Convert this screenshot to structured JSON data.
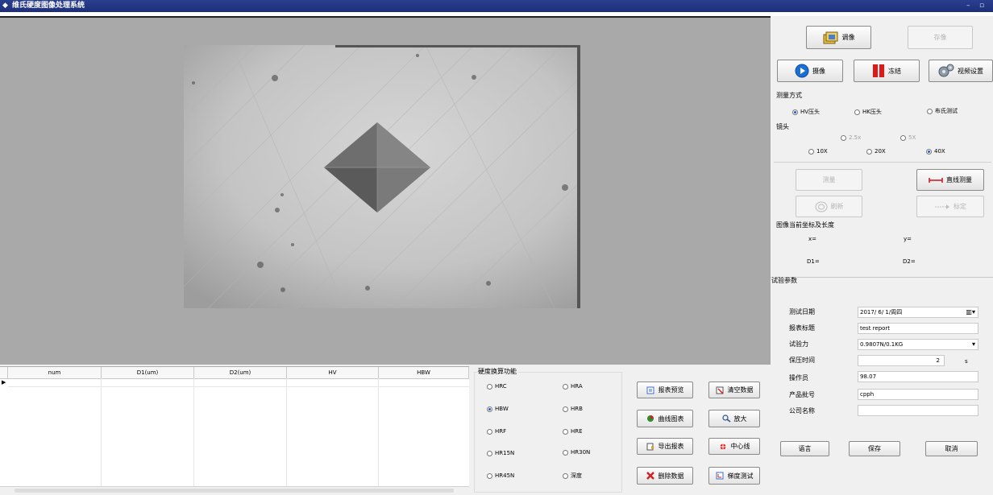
{
  "window": {
    "title": "维氏硬度图像处理系统",
    "min": "–",
    "max": "▫"
  },
  "top_buttons": {
    "capture": "调像",
    "save": "存像",
    "camera": "摄像",
    "freeze": "冻结",
    "video_settings": "视频设置"
  },
  "measure_mode": {
    "label": "测量方式",
    "options": [
      "HV压头",
      "HK压头",
      "布氏测试"
    ],
    "selected": "HV压头"
  },
  "lens": {
    "label": "镜头",
    "row1": [
      "2.5x",
      "5X"
    ],
    "row2": [
      "10X",
      "20X",
      "40X"
    ],
    "selected": "40X"
  },
  "action_buttons": {
    "measure": "测量",
    "line_measure": "直线测量",
    "refresh": "刷新",
    "calibrate": "标定"
  },
  "coords": {
    "label": "图像当前坐标及长度",
    "x": "x=",
    "y": "y=",
    "d1": "D1=",
    "d2": "D2="
  },
  "test_params": {
    "label": "试验参数",
    "fields": [
      {
        "label": "测试日期",
        "value": "2017/ 6/ 1/周四"
      },
      {
        "label": "报表标题",
        "value": "test report"
      },
      {
        "label": "试验力",
        "value": "0.9807N/0.1KG"
      },
      {
        "label": "保压时间",
        "value": "2",
        "unit": "s"
      },
      {
        "label": "操作员",
        "value": "98.07"
      },
      {
        "label": "产品批号",
        "value": "cpph"
      },
      {
        "label": "公司名称",
        "value": ""
      }
    ]
  },
  "bottom_buttons": {
    "language": "语言",
    "save": "保存",
    "cancel": "取消"
  },
  "table": {
    "columns": [
      "num",
      "D1(um)",
      "D2(um)",
      "HV",
      "HBW"
    ]
  },
  "conversion": {
    "label": "硬度换算功能",
    "options": [
      [
        "HRC",
        "HRA"
      ],
      [
        "HBW",
        "HRB"
      ],
      [
        "HRF",
        "HRE"
      ],
      [
        "HR15N",
        "HR30N"
      ],
      [
        "HR45N",
        "深度"
      ]
    ],
    "selected": "HBW"
  },
  "data_buttons": [
    "报表预览",
    "清空数据",
    "曲线图表",
    "放大",
    "导出报表",
    "中心线",
    "删除数据",
    "梯度测试"
  ],
  "colors": {
    "titlebar": "#1d2f7a",
    "viewport": "#a9a9a9",
    "line_icon": "#d0101a",
    "camera_icon": "#1b6fd4",
    "freeze_icon": "#e01818"
  }
}
